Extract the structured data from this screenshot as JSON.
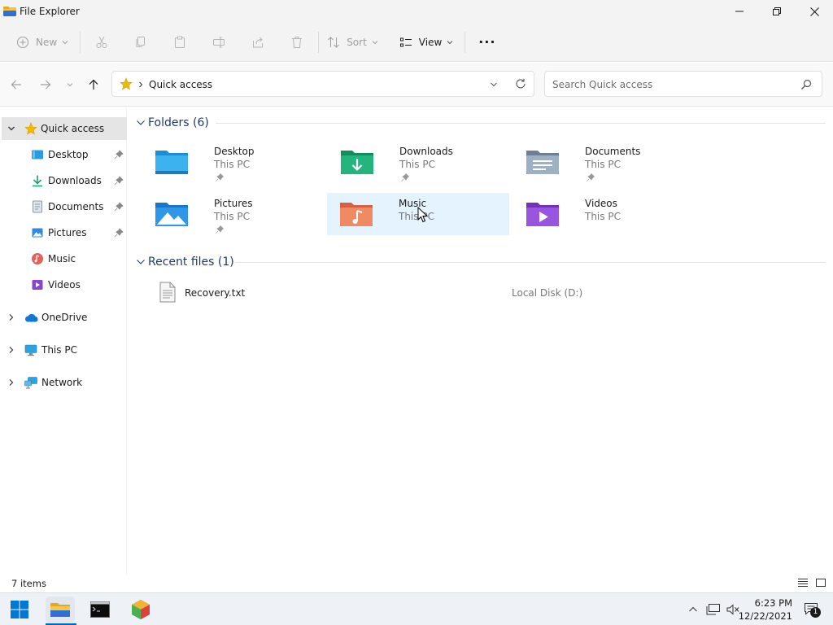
{
  "window": {
    "title": "File Explorer"
  },
  "toolbar": {
    "new_label": "New",
    "sort_label": "Sort",
    "view_label": "View",
    "more_label": "···"
  },
  "address": {
    "path_label": "Quick access",
    "search_placeholder": "Search Quick access"
  },
  "nav": {
    "quick_access": "Quick access",
    "items": [
      {
        "label": "Desktop",
        "pinned": true
      },
      {
        "label": "Downloads",
        "pinned": true
      },
      {
        "label": "Documents",
        "pinned": true
      },
      {
        "label": "Pictures",
        "pinned": true
      },
      {
        "label": "Music",
        "pinned": false
      },
      {
        "label": "Videos",
        "pinned": false
      }
    ],
    "onedrive": "OneDrive",
    "this_pc": "This PC",
    "network": "Network"
  },
  "folders": {
    "header": "Folders (6)",
    "items": [
      {
        "name": "Desktop",
        "location": "This PC"
      },
      {
        "name": "Downloads",
        "location": "This PC"
      },
      {
        "name": "Documents",
        "location": "This PC"
      },
      {
        "name": "Pictures",
        "location": "This PC"
      },
      {
        "name": "Music",
        "location": "This PC"
      },
      {
        "name": "Videos",
        "location": "This PC"
      }
    ]
  },
  "recent": {
    "header": "Recent files (1)",
    "items": [
      {
        "name": "Recovery.txt",
        "location": "Local Disk (D:)"
      }
    ]
  },
  "status": {
    "item_count": "7 items"
  },
  "taskbar": {
    "time": "6:23 PM",
    "date": "12/22/2021",
    "notification_count": "1"
  },
  "colors": {
    "accent": "#0067c0",
    "hover": "#e5f3ff",
    "selected": "#e5e5e5",
    "group_header": "#1f3a68"
  }
}
